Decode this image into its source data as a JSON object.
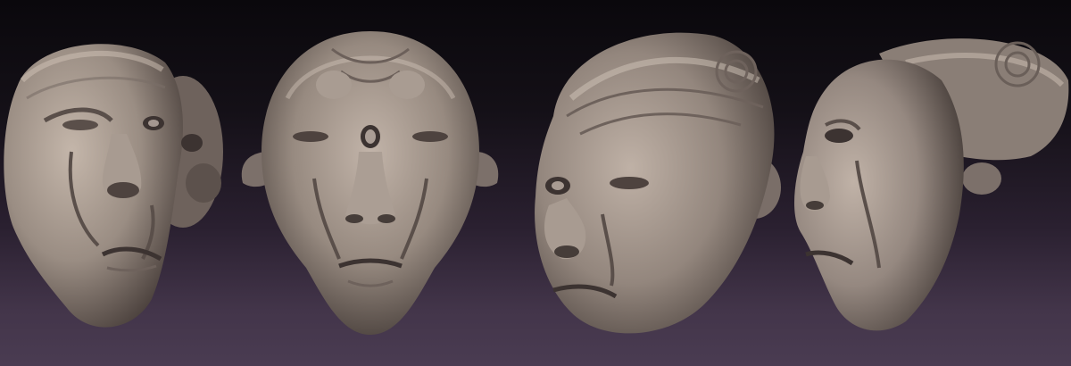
{
  "scene": {
    "background": {
      "top": "#0a080c",
      "bottom": "#4a3c52"
    },
    "clay_colors": {
      "light": "#bfb0a5",
      "mid": "#8f8279",
      "dark": "#4e433f"
    },
    "heads": [
      {
        "id": "head-1",
        "view": "three-quarter-left"
      },
      {
        "id": "head-2",
        "view": "front"
      },
      {
        "id": "head-3",
        "view": "three-quarter-right"
      },
      {
        "id": "head-4",
        "view": "profile-left"
      }
    ]
  }
}
